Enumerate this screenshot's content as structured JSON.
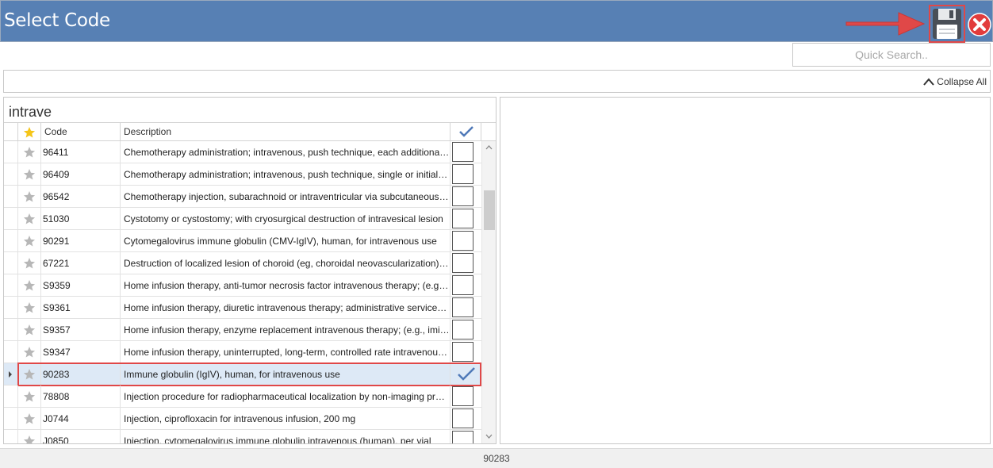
{
  "window": {
    "title": "Select Code"
  },
  "toolbar": {
    "save_icon": "floppy-disk-icon",
    "close_icon": "close-circle-icon",
    "accent": "#e04848",
    "titlebar_color": "#5780b4"
  },
  "search": {
    "placeholder": "Quick Search..",
    "value": ""
  },
  "collapse": {
    "label": "Collapse All"
  },
  "group": {
    "label": "intrave"
  },
  "grid": {
    "columns": {
      "favorite_icon": "star-icon",
      "code": "Code",
      "description": "Description",
      "selected_icon": "checkmark-icon"
    },
    "rows": [
      {
        "code": "96411",
        "description": "Chemotherapy administration; intravenous, push technique, each additional substance/drug (List separately in addition to code for primary procedure)",
        "checked": false,
        "selected": false
      },
      {
        "code": "96409",
        "description": "Chemotherapy administration; intravenous, push technique, single or initial substance/drug",
        "checked": false,
        "selected": false
      },
      {
        "code": "96542",
        "description": "Chemotherapy injection, subarachnoid or intraventricular via subcutaneous reservoir, single or multiple agents",
        "checked": false,
        "selected": false
      },
      {
        "code": "51030",
        "description": "Cystotomy or cystostomy; with cryosurgical destruction of intravesical lesion",
        "checked": false,
        "selected": false
      },
      {
        "code": "90291",
        "description": "Cytomegalovirus immune globulin (CMV-IgIV), human, for intravenous use",
        "checked": false,
        "selected": false
      },
      {
        "code": "67221",
        "description": "Destruction of localized lesion of choroid (eg, choroidal neovascularization); photodynamic therapy",
        "checked": false,
        "selected": false
      },
      {
        "code": "S9359",
        "description": "Home infusion therapy, anti-tumor necrosis factor intravenous therapy; (e.g., infliximab)",
        "checked": false,
        "selected": false
      },
      {
        "code": "S9361",
        "description": "Home infusion therapy, diuretic intravenous therapy; administrative services, professional pharmacy services",
        "checked": false,
        "selected": false
      },
      {
        "code": "S9357",
        "description": "Home infusion therapy, enzyme replacement intravenous therapy; (e.g., imiglucerase)",
        "checked": false,
        "selected": false
      },
      {
        "code": "S9347",
        "description": "Home infusion therapy, uninterrupted, long-term, controlled rate intravenous or subcutaneous infusion therapy",
        "checked": false,
        "selected": false
      },
      {
        "code": "90283",
        "description": "Immune globulin (IgIV), human, for intravenous use",
        "checked": true,
        "selected": true
      },
      {
        "code": "78808",
        "description": "Injection procedure for radiopharmaceutical localization by non-imaging probe study, intravenous",
        "checked": false,
        "selected": false
      },
      {
        "code": "J0744",
        "description": "Injection, ciprofloxacin for intravenous infusion, 200 mg",
        "checked": false,
        "selected": false
      },
      {
        "code": "J0850",
        "description": "Injection, cytomegalovirus immune globulin intravenous (human), per vial",
        "checked": false,
        "selected": false
      }
    ]
  },
  "status": {
    "text": "90283"
  }
}
